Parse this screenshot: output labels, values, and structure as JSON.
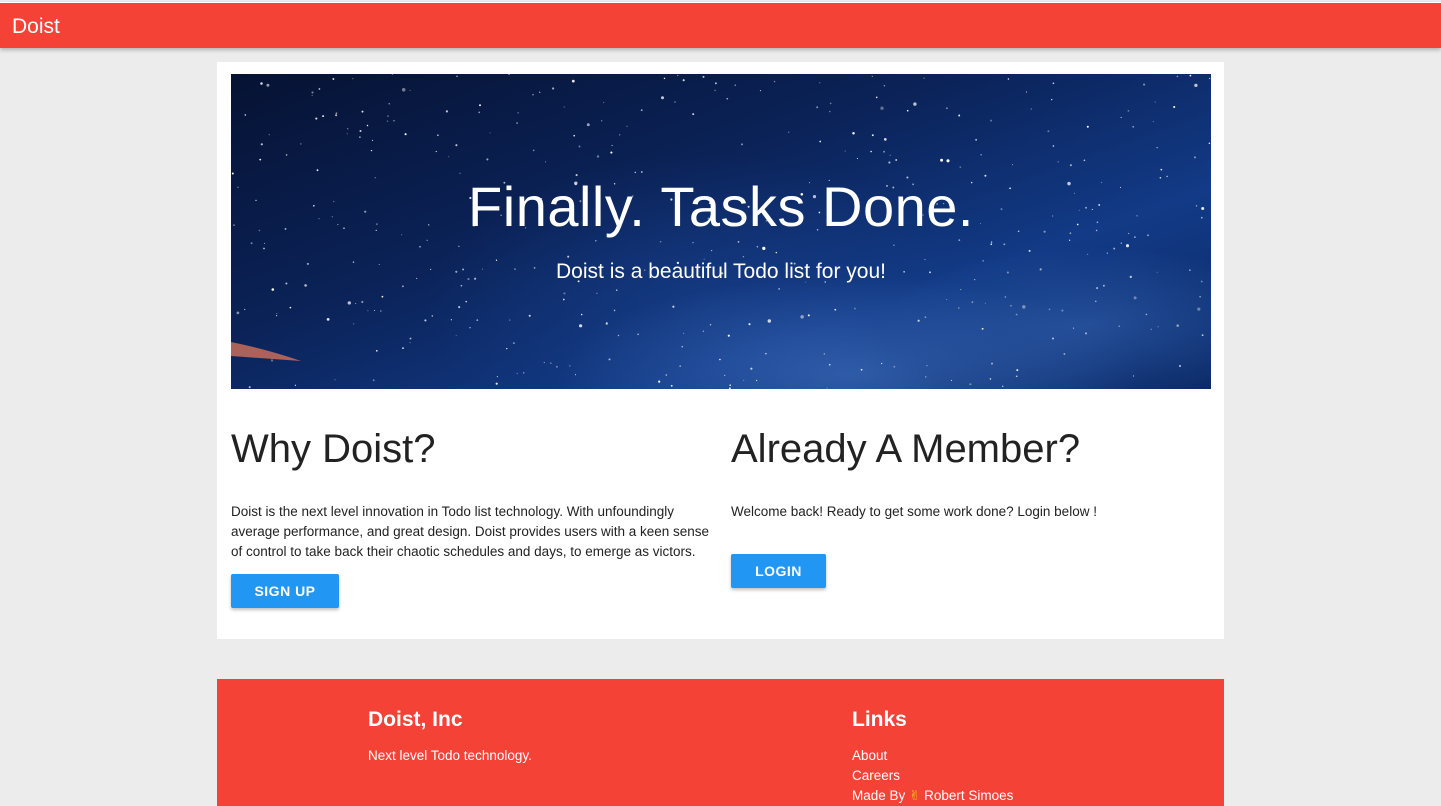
{
  "nav": {
    "brand": "Doist"
  },
  "hero": {
    "title": "Finally. Tasks Done.",
    "subtitle": "Doist is a beautiful Todo list for you!"
  },
  "why": {
    "heading": "Why Doist?",
    "body": "Doist is the next level innovation in Todo list technology. With unfoundingly average performance, and great design. Doist provides users with a keen sense of control to take back their chaotic schedules and days, to emerge as victors.",
    "button_label": "SIGN UP"
  },
  "member": {
    "heading": "Already A Member?",
    "body": "Welcome back! Ready to get some work done? Login below !",
    "button_label": "LOGIN"
  },
  "footer": {
    "company_heading": "Doist, Inc",
    "company_tagline": "Next level Todo technology.",
    "links_heading": "Links",
    "links": [
      {
        "label": "About"
      },
      {
        "label": "Careers"
      }
    ],
    "made_by_prefix": "Made By",
    "made_by_emoji": "✌",
    "made_by_name": "Robert Simoes"
  },
  "colors": {
    "primary_red": "#f44336",
    "button_blue": "#2196f3",
    "page_background": "#ececec"
  }
}
